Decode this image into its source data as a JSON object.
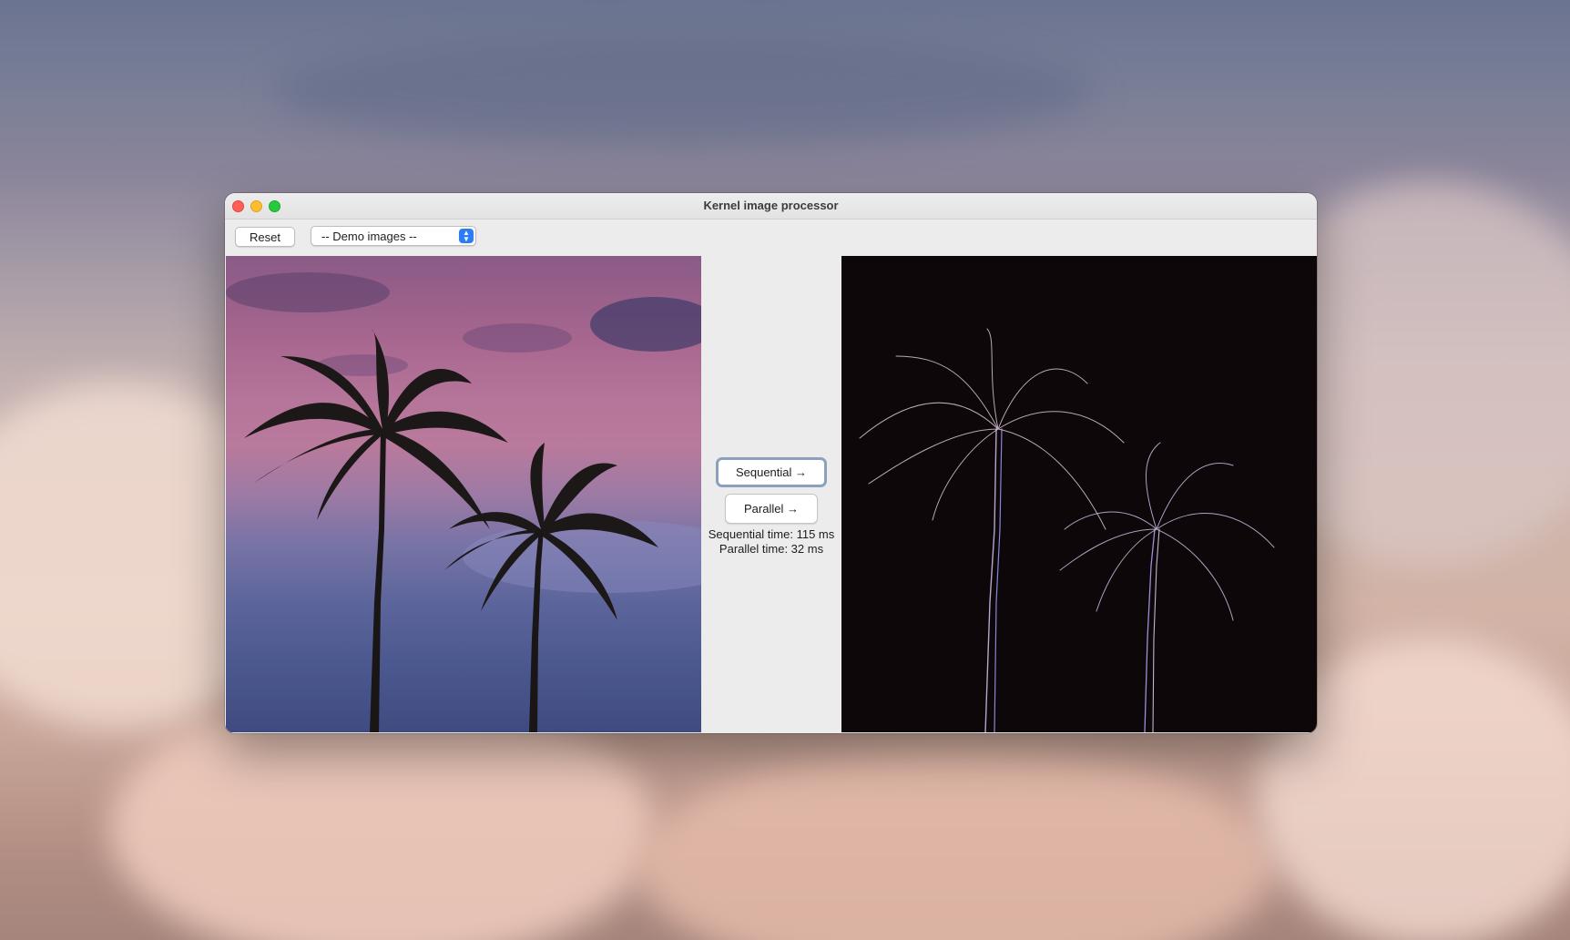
{
  "window": {
    "title": "Kernel image processor"
  },
  "toolbar": {
    "reset_label": "Reset",
    "demo_select_value": "-- Demo images --"
  },
  "actions": {
    "sequential_label": "Sequential →",
    "parallel_label": "Parallel →"
  },
  "timing": {
    "sequential_text": "Sequential time: 115 ms",
    "parallel_text": "Parallel time: 32 ms"
  },
  "images": {
    "original": "palm-trees-sunset-photo",
    "processed": "palm-trees-edge-detected-photo"
  },
  "colors": {
    "close": "#ff5f57",
    "minimize": "#febc2e",
    "maximize": "#28c840",
    "select_accent": "#2a7cf7"
  }
}
